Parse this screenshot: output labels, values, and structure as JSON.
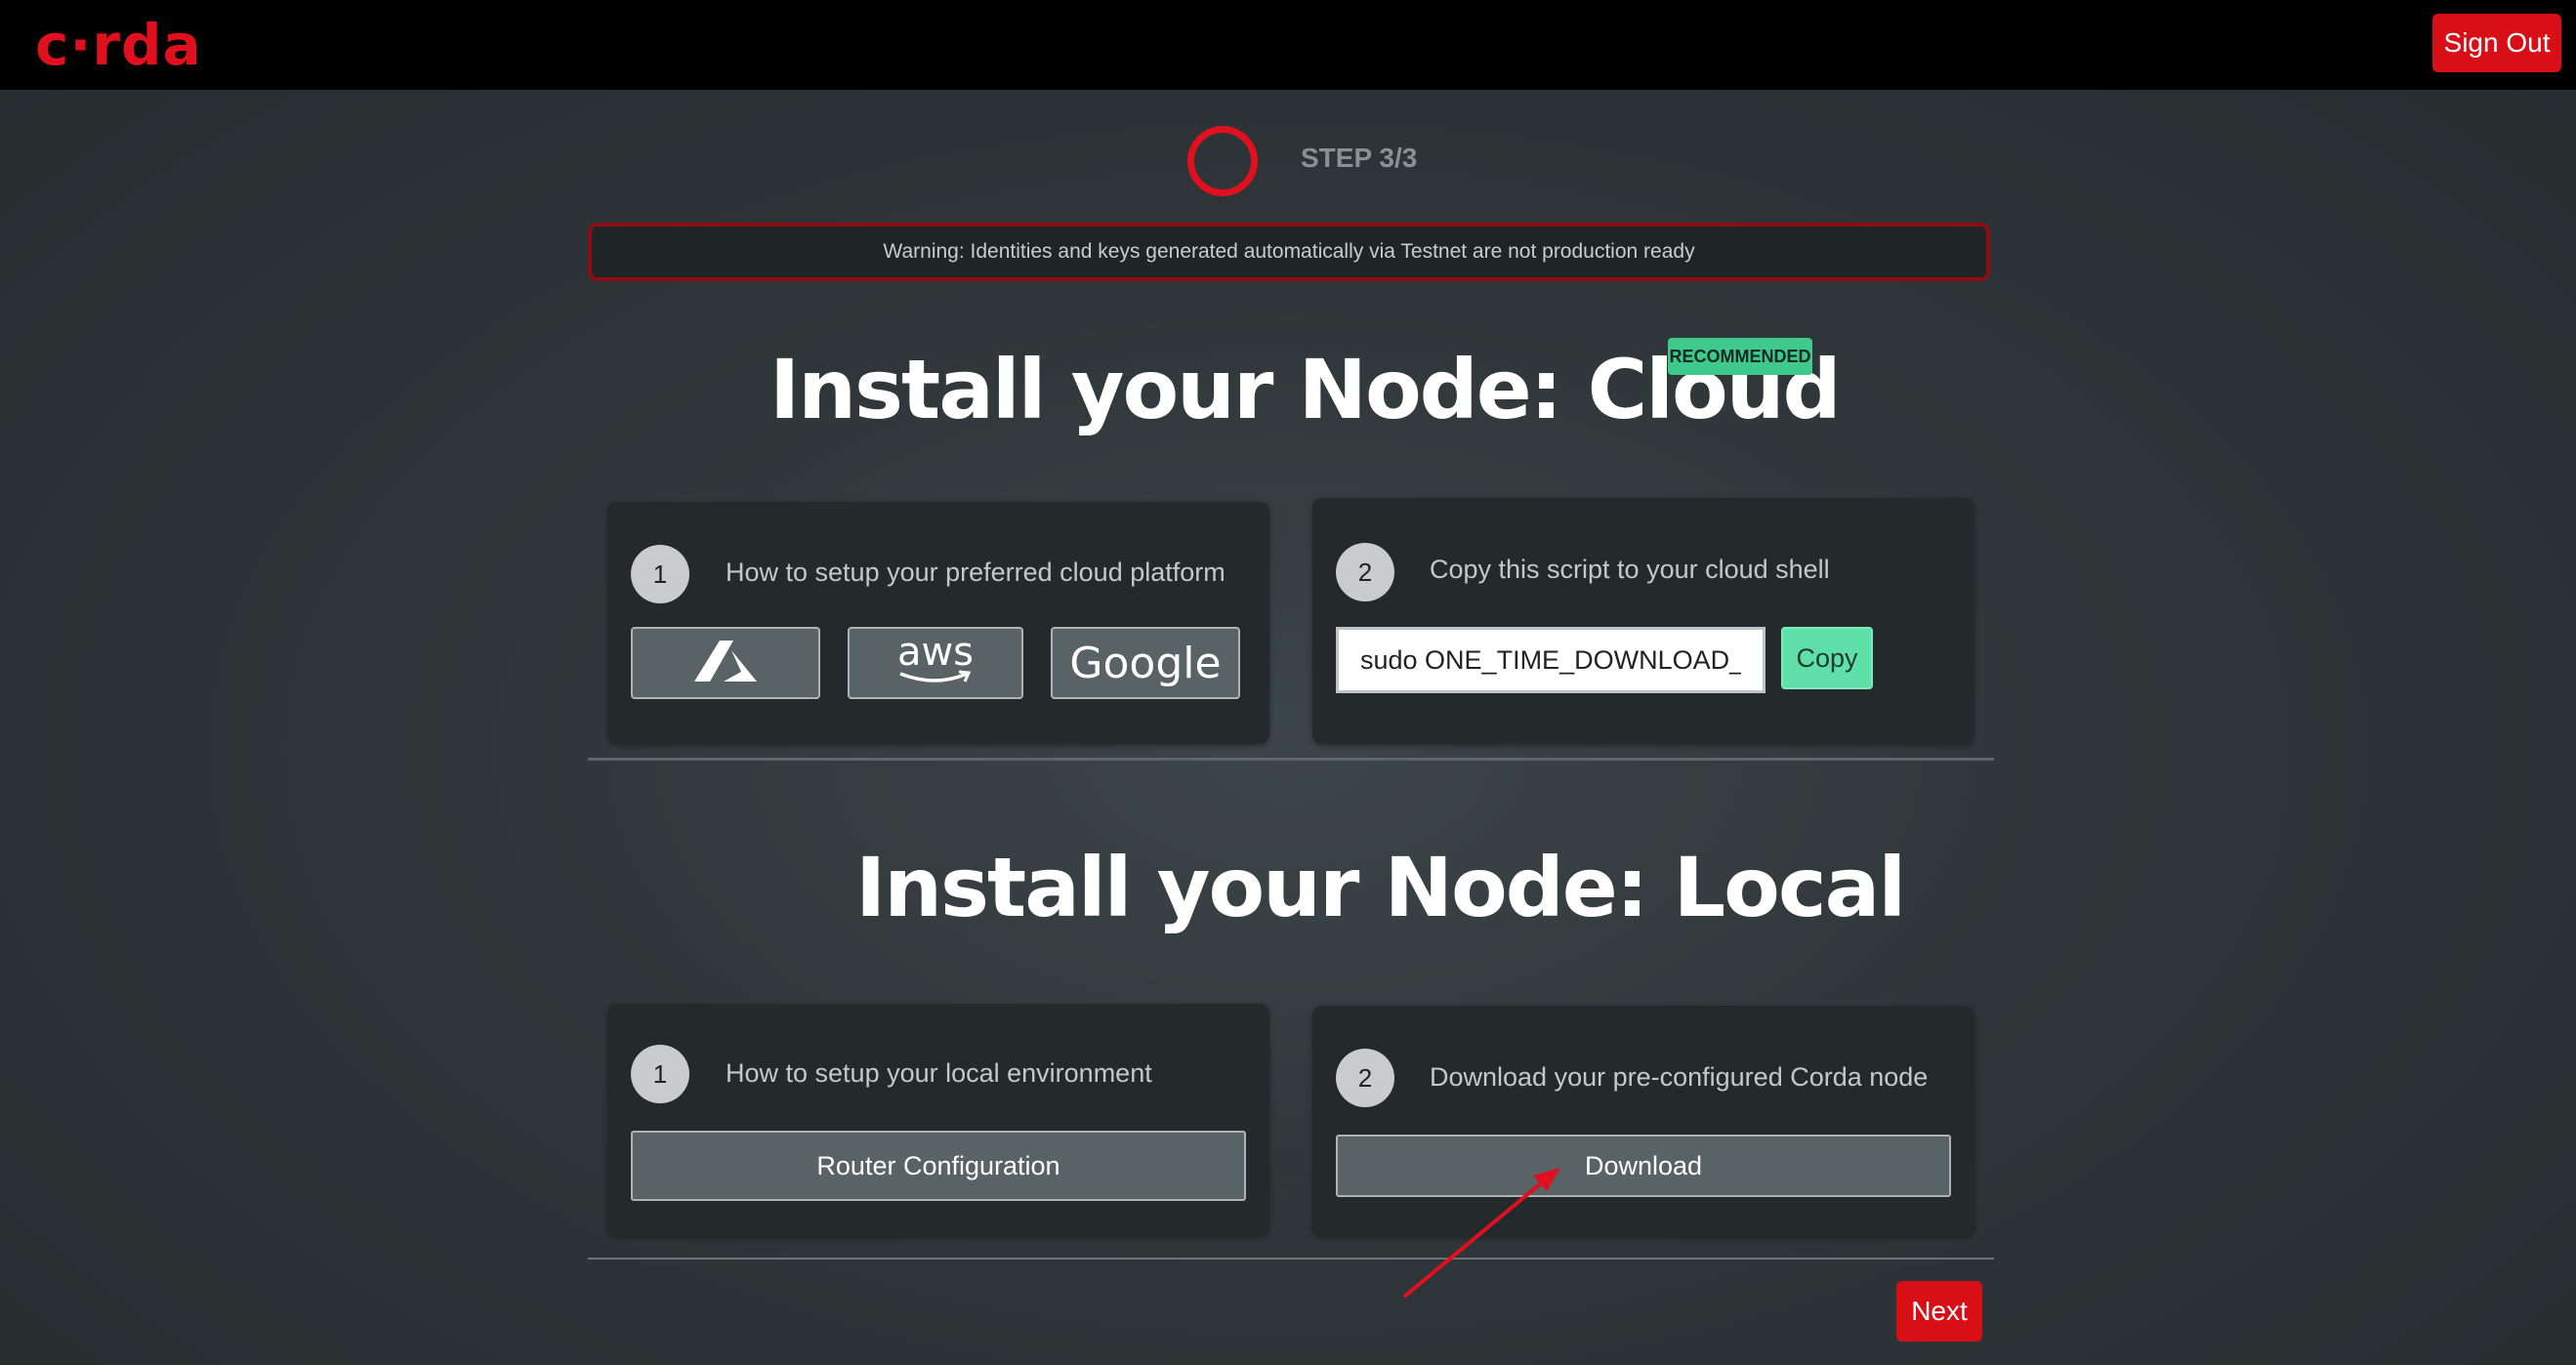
{
  "header": {
    "logo": "c·rda",
    "sign_out_label": "Sign Out"
  },
  "stepper": {
    "label": "STEP 3/3"
  },
  "warning": {
    "text": "Warning: Identities and keys generated automatically via Testnet are not production ready"
  },
  "cloud": {
    "title": "Install your Node: Cloud",
    "badge": "RECOMMENDED",
    "step1": {
      "number": "1",
      "text": "How to setup your preferred cloud platform",
      "providers": [
        {
          "name": "azure",
          "icon": "azure-logo-icon"
        },
        {
          "name": "aws",
          "label": "aws",
          "icon": "aws-logo-icon"
        },
        {
          "name": "google",
          "label": "Google",
          "icon": "google-logo-icon"
        }
      ]
    },
    "step2": {
      "number": "2",
      "text": "Copy this script to your cloud shell",
      "script_value": "sudo ONE_TIME_DOWNLOAD_KE",
      "copy_label": "Copy"
    }
  },
  "local": {
    "title": "Install your Node: Local",
    "step1": {
      "number": "1",
      "text": "How to setup your local environment",
      "button_label": "Router Configuration"
    },
    "step2": {
      "number": "2",
      "text": "Download your pre-configured Corda node",
      "button_label": "Download"
    }
  },
  "footer": {
    "next_label": "Next"
  },
  "colors": {
    "brand_red": "#e0101e",
    "button_red": "#d90f18",
    "badge_green": "#3fc98d",
    "copy_green": "#5fe0a8",
    "topbar": "#000000"
  }
}
